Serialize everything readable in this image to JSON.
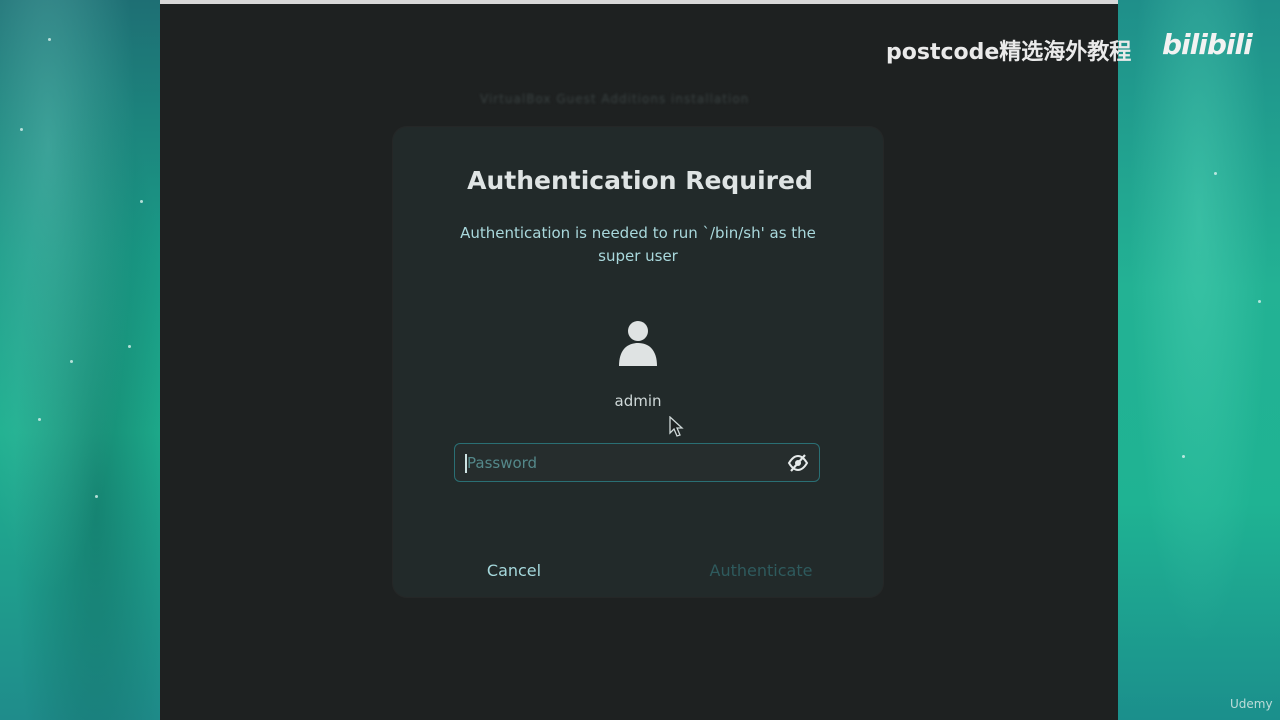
{
  "background_window": {
    "blurred_text": "VirtualBox Guest Additions installation"
  },
  "dialog": {
    "title": "Authentication Required",
    "message": "Authentication is needed to run `/bin/sh' as the super user",
    "user": {
      "icon": "user-icon",
      "name": "admin"
    },
    "password_field": {
      "placeholder": "Password",
      "value": "",
      "reveal_icon": "eye-slash-icon"
    },
    "buttons": {
      "cancel": "Cancel",
      "authenticate": "Authenticate"
    }
  },
  "overlay": {
    "watermark": "postcode精选海外教程",
    "logo": "bilibili",
    "corner_mark": "Udemy"
  },
  "colors": {
    "dialog_bg": "#222a2a",
    "accent_text": "#a9d8dc",
    "field_border": "#2a6f74",
    "disabled_button": "#2e5a5d",
    "wallpaper": "#1fb08f"
  }
}
